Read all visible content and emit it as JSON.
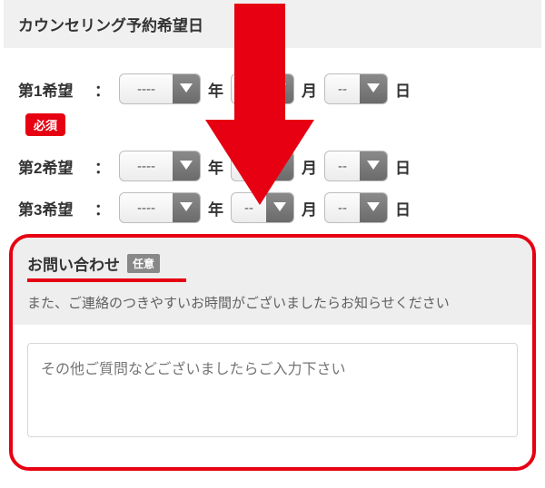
{
  "section_title": "カウンセリング予約希望日",
  "required_label": "必須",
  "optional_label": "任意",
  "date_units": {
    "year": "年",
    "month": "月",
    "day": "日"
  },
  "prefs": [
    {
      "label": "第1希望",
      "year": "----",
      "month": "--",
      "day": "--"
    },
    {
      "label": "第2希望",
      "year": "----",
      "month": "--",
      "day": "--"
    },
    {
      "label": "第3希望",
      "year": "----",
      "month": "--",
      "day": "--"
    }
  ],
  "inquiry": {
    "title": "お問い合わせ",
    "subtitle": "また、ご連絡のつきやすいお時間がございましたらお知らせください",
    "placeholder": "その他ご質問などございましたらご入力下さい"
  },
  "colors": {
    "accent": "#e60012"
  }
}
